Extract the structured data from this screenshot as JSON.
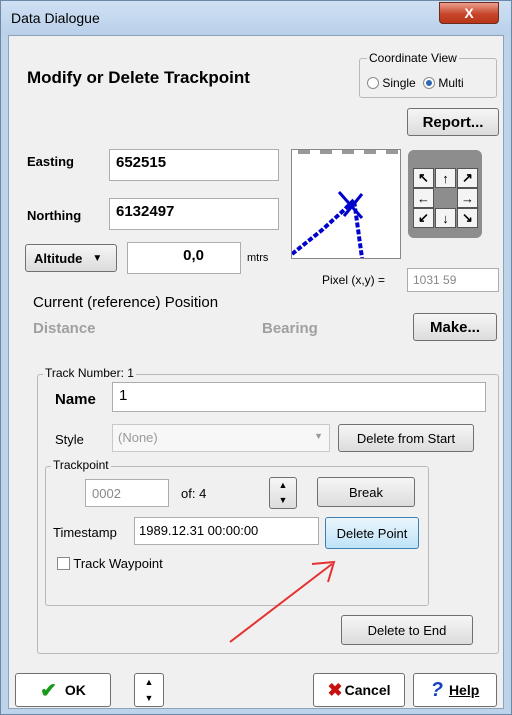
{
  "window": {
    "title": "Data Dialogue",
    "close_label": "X"
  },
  "header": {
    "heading": "Modify or Delete Trackpoint",
    "coordinate_view": {
      "label": "Coordinate View",
      "single_label": "Single",
      "multi_label": "Multi",
      "selected": "Multi"
    },
    "report_button": "Report..."
  },
  "position": {
    "easting_label": "Easting",
    "easting_value": "652515",
    "northing_label": "Northing",
    "northing_value": "6132497",
    "altitude_label": "Altitude",
    "altitude_value": "0,0",
    "altitude_unit": "mtrs",
    "pixel_label": "Pixel (x,y) =",
    "pixel_value": "1031 59"
  },
  "nav_pad": {
    "nw": "↖",
    "n": "↑",
    "ne": "↗",
    "w": "←",
    "e": "→",
    "sw": "↙",
    "s": "↓",
    "se": "↘"
  },
  "reference": {
    "current_label": "Current (reference) Position",
    "distance_label": "Distance",
    "bearing_label": "Bearing",
    "make_button": "Make..."
  },
  "track": {
    "group_label": "Track Number: 1",
    "name_label": "Name",
    "name_value": "1",
    "style_label": "Style",
    "style_value": "(None)",
    "delete_from_start": "Delete from Start",
    "trackpoint": {
      "group_label": "Trackpoint",
      "index_value": "0002",
      "of_label": "of: 4",
      "break_button": "Break",
      "timestamp_label": "Timestamp",
      "timestamp_value": "1989.12.31 00:00:00",
      "delete_point": "Delete Point",
      "waypoint_label": "Track Waypoint"
    },
    "delete_to_end": "Delete to End"
  },
  "footer": {
    "ok": "OK",
    "cancel": "Cancel",
    "help": "Help"
  },
  "colors": {
    "track_line": "#0000cc",
    "annotation_arrow": "#e53030",
    "check_green": "#1a9a1a",
    "cancel_x": "#c81010",
    "help_q": "#1240c0"
  }
}
